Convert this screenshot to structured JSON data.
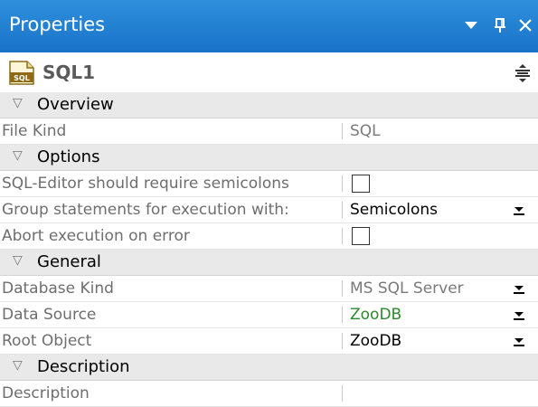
{
  "panel": {
    "title": "Properties",
    "object_name": "SQL1",
    "accent_color": "#1873c8",
    "icons": {
      "dropdown": "triangle-down-icon",
      "pin": "pin-icon",
      "close": "close-icon",
      "file": "sql-file-icon",
      "sort": "categorize-icon"
    }
  },
  "sections": [
    {
      "label": "Overview",
      "rows": [
        {
          "name": "File Kind",
          "value": "SQL",
          "value_style": "gray",
          "control": "none"
        }
      ]
    },
    {
      "label": "Options",
      "rows": [
        {
          "name": "SQL-Editor should require semicolons",
          "value": "",
          "checked": false,
          "control": "checkbox"
        },
        {
          "name": "Group statements for execution with:",
          "value": "Semicolons",
          "value_style": "black",
          "control": "dropdown"
        },
        {
          "name": "Abort execution on error",
          "value": "",
          "checked": false,
          "control": "checkbox"
        }
      ]
    },
    {
      "label": "General",
      "rows": [
        {
          "name": "Database Kind",
          "value": "MS SQL Server",
          "value_style": "gray",
          "control": "dropdown"
        },
        {
          "name": "Data Source",
          "value": "ZooDB",
          "value_style": "green",
          "control": "dropdown"
        },
        {
          "name": "Root Object",
          "value": "ZooDB",
          "value_style": "black",
          "control": "dropdown"
        }
      ]
    },
    {
      "label": "Description",
      "rows": [
        {
          "name": "Description",
          "value": "",
          "control": "none"
        }
      ]
    }
  ]
}
